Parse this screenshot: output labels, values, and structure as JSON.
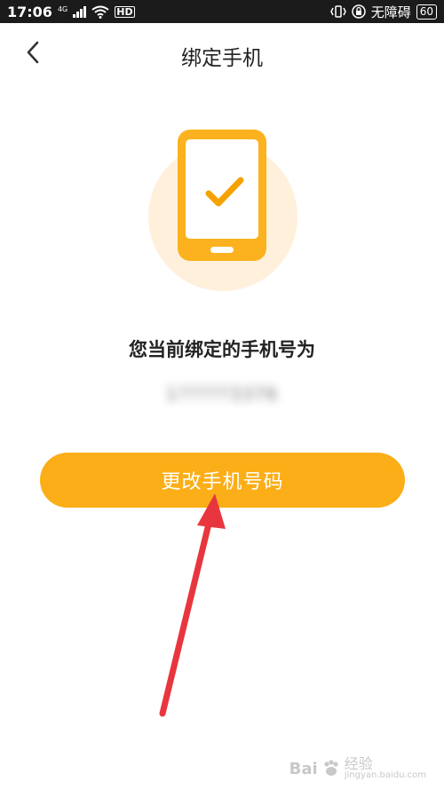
{
  "status_bar": {
    "time": "17:06",
    "network": "4G",
    "hd": "HD",
    "status_text": "无障碍",
    "battery": "60"
  },
  "header": {
    "title": "绑定手机",
    "back_icon": "chevron-left-icon"
  },
  "main": {
    "illustration_icon": "phone-check-icon",
    "label": "您当前绑定的手机号为",
    "phone_masked": "1?????3376",
    "button_label": "更改手机号码"
  },
  "annotation": {
    "icon": "red-arrow-icon",
    "color": "#e8363e"
  },
  "watermark": {
    "brand": "Bai",
    "brand_suffix": "经验",
    "url": "jingyan.baidu.com"
  },
  "colors": {
    "accent": "#fbae17",
    "circle_bg": "#fff0dc",
    "check": "#f5a300"
  }
}
